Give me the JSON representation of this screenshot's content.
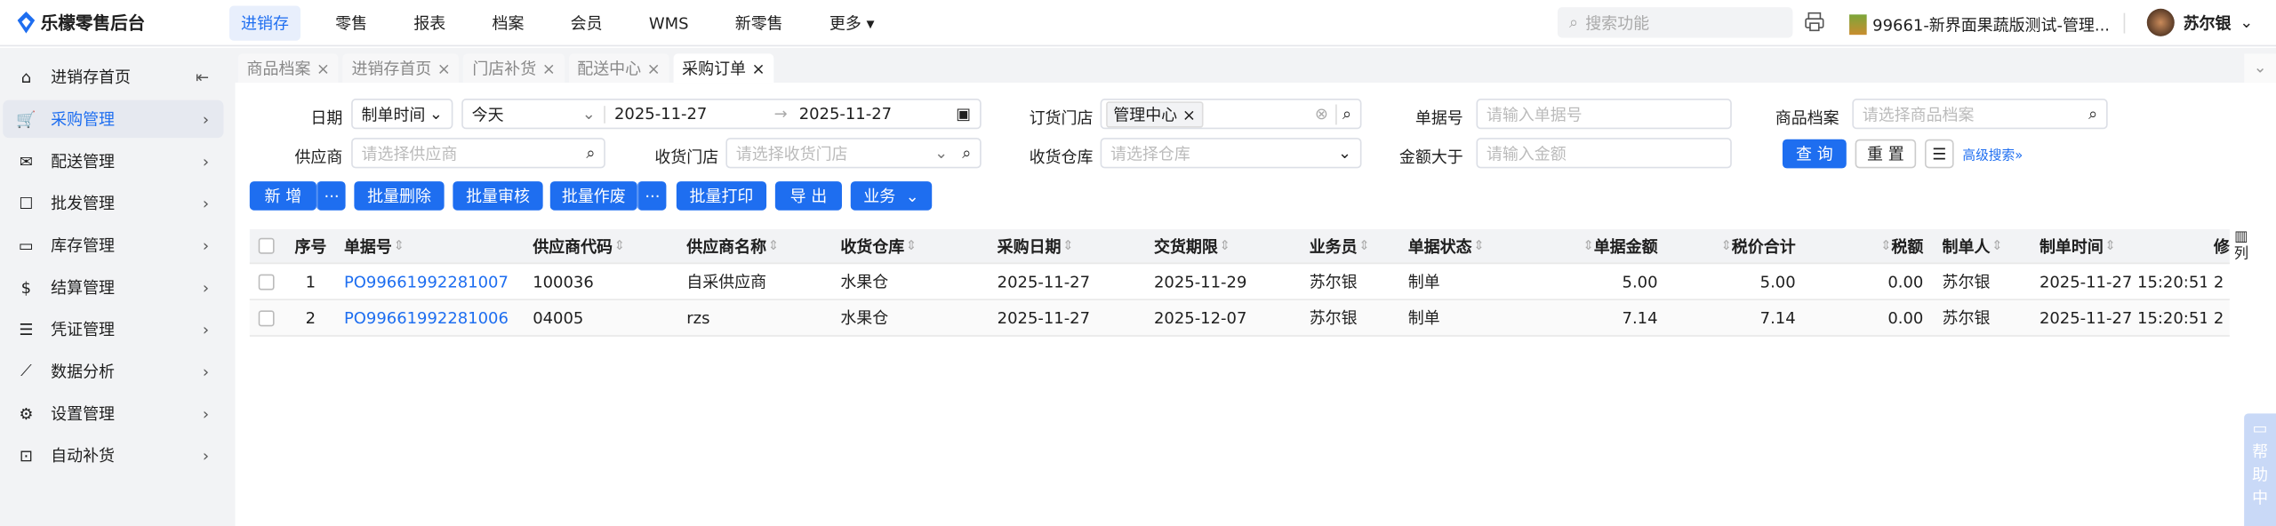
{
  "app": {
    "title": "乐檬零售后台"
  },
  "topnav": [
    {
      "label": "进销存",
      "active": true
    },
    {
      "label": "零售"
    },
    {
      "label": "报表"
    },
    {
      "label": "档案"
    },
    {
      "label": "会员"
    },
    {
      "label": "WMS"
    },
    {
      "label": "新零售"
    },
    {
      "label": "更多"
    }
  ],
  "search": {
    "placeholder": "搜索功能"
  },
  "store": {
    "name": "99661-新界面果蔬版测试-管理..."
  },
  "user": {
    "name": "苏尔银"
  },
  "sidebar": {
    "items": [
      {
        "label": "进销存首页",
        "icon": "home-icon"
      },
      {
        "label": "采购管理",
        "icon": "cart-icon",
        "active": true
      },
      {
        "label": "配送管理",
        "icon": "delivery-icon"
      },
      {
        "label": "批发管理",
        "icon": "wholesale-icon"
      },
      {
        "label": "库存管理",
        "icon": "inventory-icon"
      },
      {
        "label": "结算管理",
        "icon": "settlement-icon"
      },
      {
        "label": "凭证管理",
        "icon": "voucher-icon"
      },
      {
        "label": "数据分析",
        "icon": "chart-icon"
      },
      {
        "label": "设置管理",
        "icon": "settings-icon"
      },
      {
        "label": "自动补货",
        "icon": "replenish-icon"
      }
    ]
  },
  "tabs": [
    {
      "label": "商品档案"
    },
    {
      "label": "进销存首页"
    },
    {
      "label": "门店补货"
    },
    {
      "label": "配送中心"
    },
    {
      "label": "采购订单",
      "active": true
    }
  ],
  "filters": {
    "date_label": "日期",
    "date_type": "制单时间",
    "date_range": "今天",
    "date_start": "2025-11-27",
    "date_end": "2025-11-27",
    "order_store_label": "订货门店",
    "order_store_tag": "管理中心",
    "doc_no_label": "单据号",
    "doc_no_placeholder": "请输入单据号",
    "product_label": "商品档案",
    "product_placeholder": "请选择商品档案",
    "supplier_label": "供应商",
    "supplier_placeholder": "请选择供应商",
    "recv_store_label": "收货门店",
    "recv_store_placeholder": "请选择收货门店",
    "warehouse_label": "收货仓库",
    "warehouse_placeholder": "请选择仓库",
    "amount_label": "金额大于",
    "amount_placeholder": "请输入金额",
    "query": "查 询",
    "reset": "重 置",
    "advanced": "高级搜索"
  },
  "toolbar": {
    "add": "新 增",
    "batch_delete": "批量删除",
    "batch_audit": "批量审核",
    "batch_void": "批量作废",
    "batch_print": "批量打印",
    "export": "导 出",
    "business": "业务",
    "more": "···"
  },
  "table": {
    "columns": [
      "序号",
      "单据号",
      "供应商代码",
      "供应商名称",
      "收货仓库",
      "采购日期",
      "交货期限",
      "业务员",
      "单据状态",
      "单据金额",
      "税价合计",
      "税额",
      "制单人",
      "制单时间",
      "修"
    ],
    "rows": [
      [
        "1",
        "PO99661992281007",
        "100036",
        "自采供应商",
        "水果仓",
        "2025-11-27",
        "2025-11-29",
        "苏尔银",
        "制单",
        "5.00",
        "5.00",
        "0.00",
        "苏尔银",
        "2025-11-27 15:20:51",
        "2"
      ],
      [
        "2",
        "PO99661992281006",
        "04005",
        "rzs",
        "水果仓",
        "2025-11-27",
        "2025-12-07",
        "苏尔银",
        "制单",
        "7.14",
        "7.14",
        "0.00",
        "苏尔银",
        "2025-11-27 15:20:51",
        "2"
      ]
    ],
    "column_settings": "列"
  },
  "help": {
    "label": "帮助中"
  }
}
